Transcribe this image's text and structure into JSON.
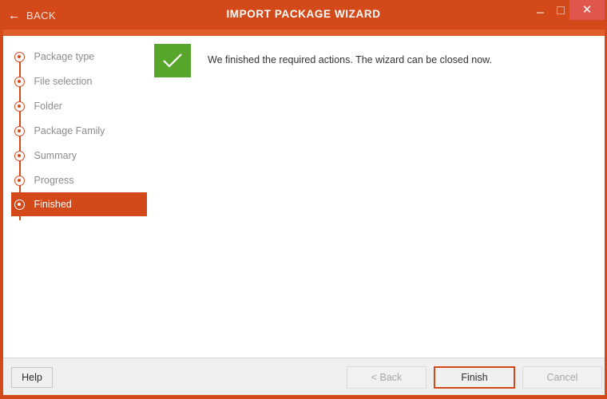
{
  "titlebar": {
    "back_label": "BACK",
    "back_icon": "arrow-left-icon",
    "title": "IMPORT PACKAGE WIZARD",
    "minimize_icon": "minimize-icon",
    "maximize_icon": "maximize-icon",
    "close_icon": "close-icon",
    "close_glyph": "✕",
    "back_glyph": "←",
    "bar_color": "#d4491a",
    "strip_color": "#de5f2c",
    "close_color": "#e0564e"
  },
  "sidebar": {
    "steps": [
      {
        "label": "Package type",
        "selected": false
      },
      {
        "label": "File selection",
        "selected": false
      },
      {
        "label": "Folder",
        "selected": false
      },
      {
        "label": "Package Family",
        "selected": false
      },
      {
        "label": "Summary",
        "selected": false
      },
      {
        "label": "Progress",
        "selected": false
      },
      {
        "label": "Finished",
        "selected": true
      }
    ],
    "selected_color": "#d4491a",
    "label_color": "#8c8c8c"
  },
  "content": {
    "status_icon": "checkmark-icon",
    "status_color": "#58a52b",
    "message": "We finished the required actions. The wizard can be closed now."
  },
  "footer": {
    "help_label": "Help",
    "back_label": "< Back",
    "finish_label": "Finish",
    "cancel_label": "Cancel",
    "back_disabled": true,
    "cancel_disabled": true,
    "finish_accent": "#d4491a"
  }
}
